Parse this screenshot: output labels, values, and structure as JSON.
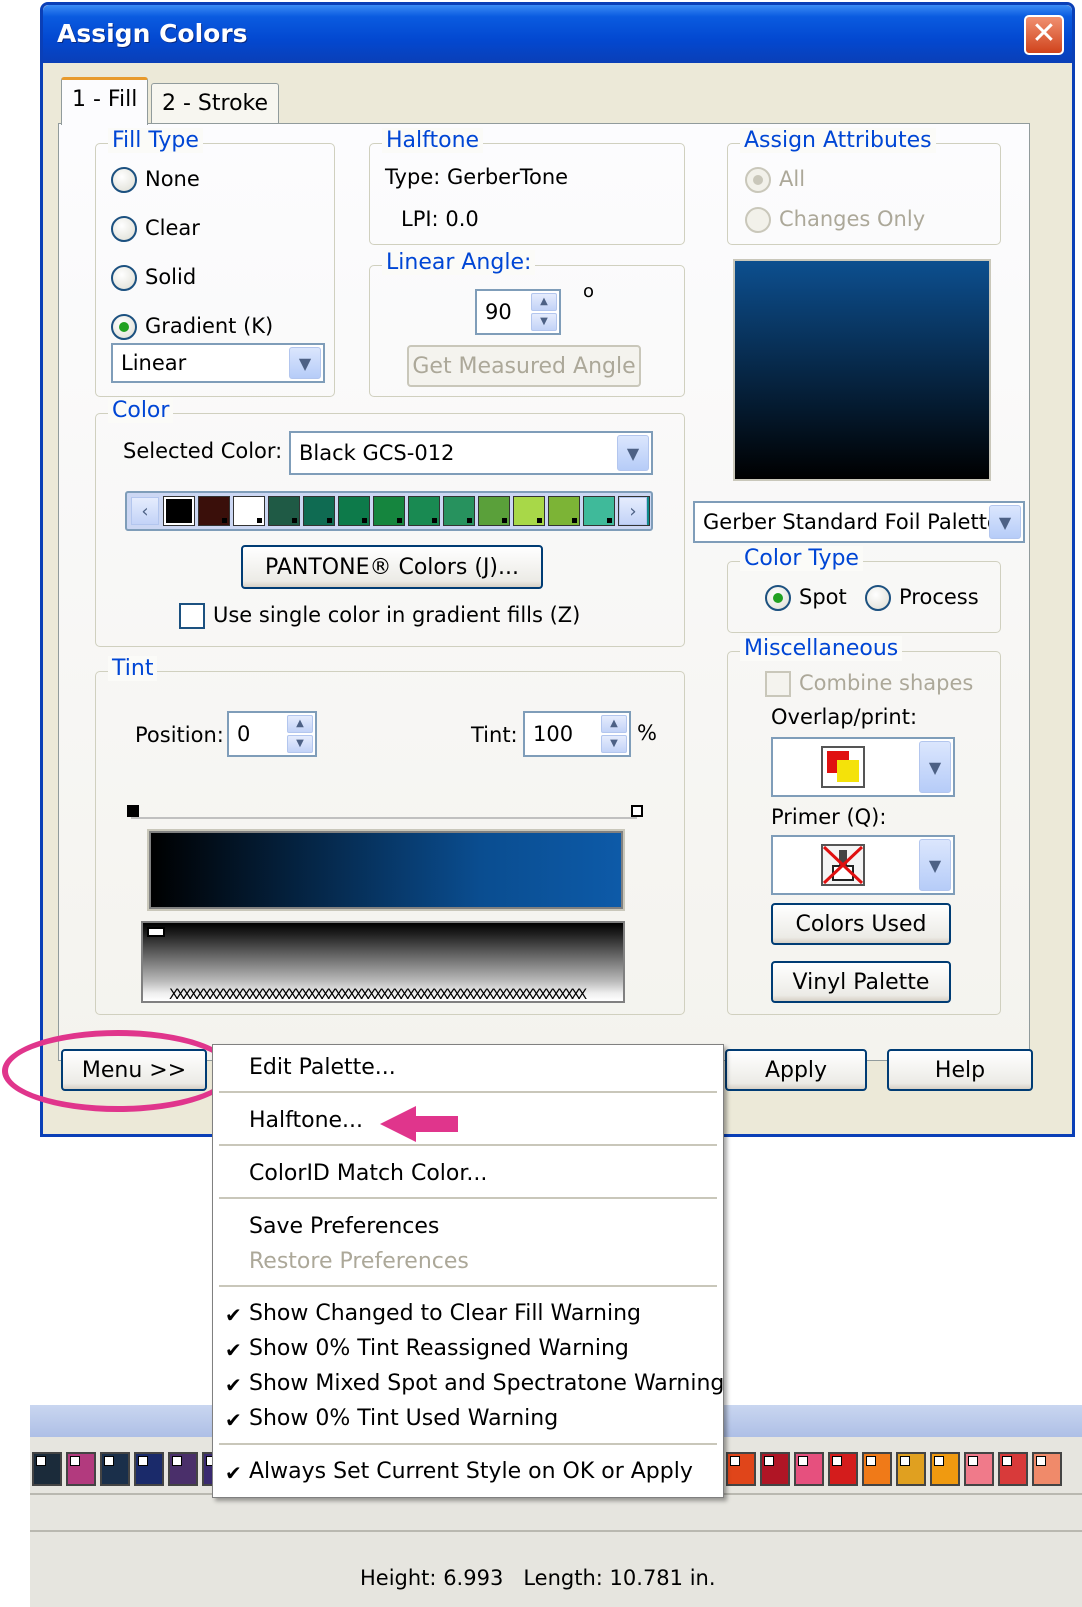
{
  "dialog": {
    "title": "Assign Colors",
    "tabs": [
      {
        "label": "1 - Fill",
        "active": true
      },
      {
        "label": "2 - Stroke",
        "active": false
      }
    ]
  },
  "fill_type": {
    "legend": "Fill Type",
    "options": [
      "None",
      "Clear",
      "Solid",
      "Gradient (K)"
    ],
    "selected": "Gradient (K)",
    "gradient_style": "Linear"
  },
  "halftone": {
    "legend": "Halftone",
    "type_label": "Type:",
    "type_value": "GerberTone",
    "lpi_label": "LPI:",
    "lpi_value": "0.0"
  },
  "linear_angle": {
    "legend": "Linear Angle:",
    "value": "90",
    "unit": "o",
    "measure_button": "Get Measured Angle"
  },
  "assign_attributes": {
    "legend": "Assign Attributes",
    "options": [
      "All",
      "Changes Only"
    ],
    "selected": "All"
  },
  "color": {
    "legend": "Color",
    "selected_label": "Selected Color:",
    "selected_value": "Black GCS-012",
    "pantone_button": "PANTONE® Colors (J)...",
    "single_color_label": "Use single color in gradient fills (Z)",
    "palette_swatches": [
      "#000000",
      "#3a0f0a",
      "#ffffff",
      "#1f5a45",
      "#0f6b52",
      "#0d7a4a",
      "#15853e",
      "#198a52",
      "#27925e",
      "#5aa03a",
      "#a8d848",
      "#7cb436",
      "#3fba9a",
      "#0f8a8a"
    ]
  },
  "palette_name": "Gerber Standard Foil Palette",
  "color_type": {
    "legend": "Color Type",
    "options": [
      "Spot",
      "Process"
    ],
    "selected": "Spot"
  },
  "misc": {
    "legend": "Miscellaneous",
    "combine_label": "Combine shapes",
    "overlap_label": "Overlap/print:",
    "primer_label": "Primer (Q):",
    "colors_used_button": "Colors Used",
    "vinyl_palette_button": "Vinyl Palette"
  },
  "tint": {
    "legend": "Tint",
    "position_label": "Position:",
    "position_value": "0",
    "tint_label": "Tint:",
    "tint_value": "100",
    "tint_unit": "%"
  },
  "footer": {
    "menu_button": "Menu >>",
    "apply_button": "Apply",
    "help_button": "Help"
  },
  "menu": {
    "items": [
      {
        "label": "Edit Palette...",
        "checked": false,
        "enabled": true
      },
      {
        "label": "Halftone...",
        "checked": false,
        "enabled": true
      },
      {
        "label": "ColorID Match Color...",
        "checked": false,
        "enabled": true
      },
      {
        "label": "Save Preferences",
        "checked": false,
        "enabled": true
      },
      {
        "label": "Restore Preferences",
        "checked": false,
        "enabled": false
      },
      {
        "label": "Show Changed to Clear Fill Warning",
        "checked": true,
        "enabled": true
      },
      {
        "label": "Show 0% Tint Reassigned Warning",
        "checked": true,
        "enabled": true
      },
      {
        "label": "Show Mixed Spot and Spectratone Warning",
        "checked": true,
        "enabled": true
      },
      {
        "label": "Show 0% Tint Used Warning",
        "checked": true,
        "enabled": true
      },
      {
        "label": "Always Set Current Style on OK or Apply",
        "checked": true,
        "enabled": true
      }
    ]
  },
  "status_bar": {
    "height_label": "Height:",
    "height_value": "6.993",
    "length_label": "Length:",
    "length_value": "10.781",
    "unit": "in."
  },
  "annotation_colors": {
    "highlight": "#e0358c"
  }
}
